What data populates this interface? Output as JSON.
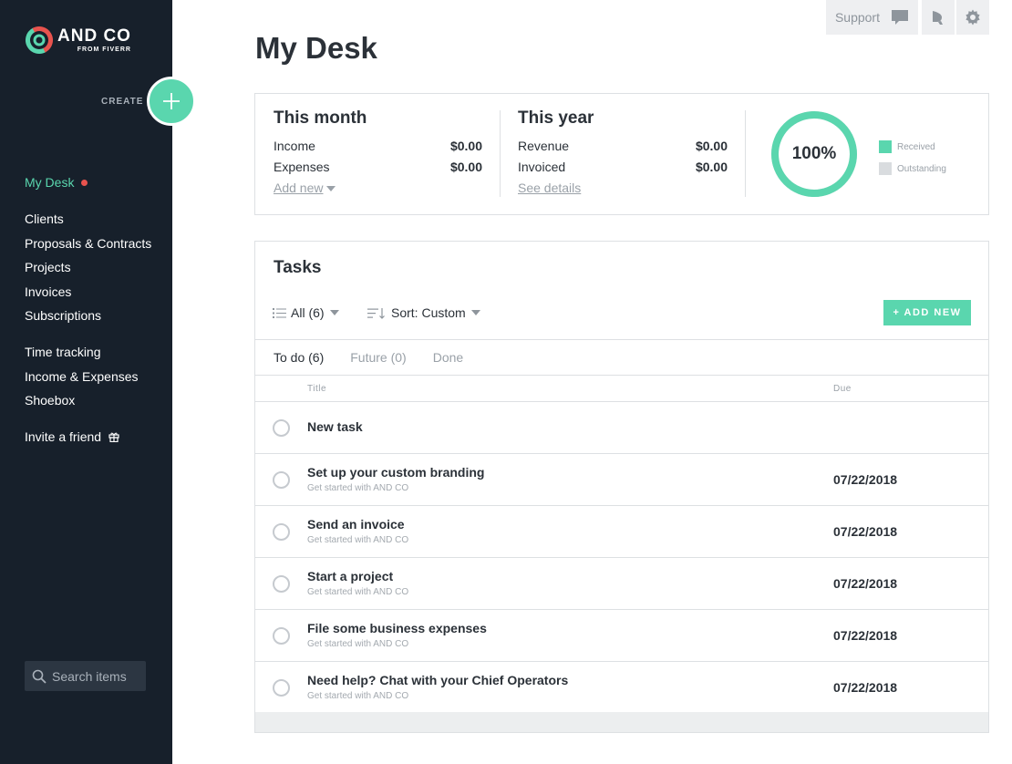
{
  "brand": {
    "name": "AND CO",
    "sub": "FROM FIVERR",
    "accent": "#5ad6ae",
    "sidebar_bg": "#17202b",
    "alert": "#e8534e"
  },
  "sidebar": {
    "create_label": "CREATE",
    "active_item": "My Desk",
    "groups": [
      [
        "Clients",
        "Proposals & Contracts",
        "Projects",
        "Invoices",
        "Subscriptions"
      ],
      [
        "Time tracking",
        "Income & Expenses",
        "Shoebox"
      ],
      [
        "Invite a friend"
      ]
    ],
    "search_placeholder": "Search items"
  },
  "topbar": {
    "support_label": "Support"
  },
  "page": {
    "title": "My Desk"
  },
  "summary": {
    "month": {
      "title": "This month",
      "rows": [
        {
          "label": "Income",
          "value": "$0.00"
        },
        {
          "label": "Expenses",
          "value": "$0.00"
        }
      ],
      "link": "Add new"
    },
    "year": {
      "title": "This year",
      "rows": [
        {
          "label": "Revenue",
          "value": "$0.00"
        },
        {
          "label": "Invoiced",
          "value": "$0.00"
        }
      ],
      "link": "See details"
    },
    "donut": {
      "label": "100%",
      "received_fraction": 1.0
    },
    "legend": [
      {
        "label": "Received",
        "color": "#5ad6ae"
      },
      {
        "label": "Outstanding",
        "color": "#d9dcdf"
      }
    ]
  },
  "tasks": {
    "title": "Tasks",
    "filter_label": "All (6)",
    "sort_label": "Sort: Custom",
    "add_label": "+ ADD NEW",
    "tabs": [
      "To do (6)",
      "Future (0)",
      "Done"
    ],
    "columns": {
      "title": "Title",
      "due": "Due"
    },
    "items": [
      {
        "title": "New task",
        "subtitle": "",
        "due": ""
      },
      {
        "title": "Set up your custom branding",
        "subtitle": "Get started with AND CO",
        "due": "07/22/2018"
      },
      {
        "title": "Send an invoice",
        "subtitle": "Get started with AND CO",
        "due": "07/22/2018"
      },
      {
        "title": "Start a project",
        "subtitle": "Get started with AND CO",
        "due": "07/22/2018"
      },
      {
        "title": "File some business expenses",
        "subtitle": "Get started with AND CO",
        "due": "07/22/2018"
      },
      {
        "title": "Need help? Chat with your Chief Operators",
        "subtitle": "Get started with AND CO",
        "due": "07/22/2018"
      }
    ]
  }
}
